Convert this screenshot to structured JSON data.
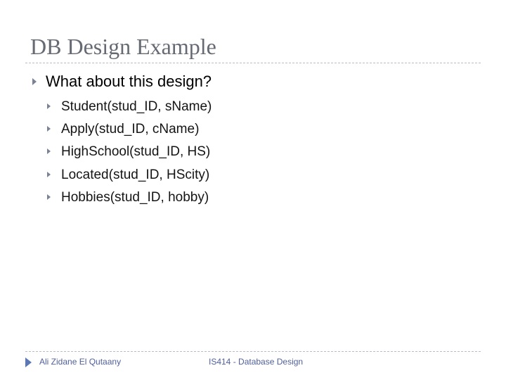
{
  "slide": {
    "title": "DB Design Example",
    "bullet": "What about this design?",
    "sub_bullets": [
      "Student(stud_ID, sName)",
      "Apply(stud_ID, cName)",
      "HighSchool(stud_ID, HS)",
      "Located(stud_ID, HScity)",
      "Hobbies(stud_ID, hobby)"
    ]
  },
  "footer": {
    "author": "Ali Zidane El Qutaany",
    "course": "IS414 - Database Design"
  },
  "icons": {
    "bullet": "triangle-right-icon",
    "footer": "triangle-right-icon"
  },
  "colors": {
    "title": "#666a73",
    "bullet_arrow": "#7b8294",
    "footer_text": "#51609b",
    "footer_arrow": "#5b78b5"
  }
}
